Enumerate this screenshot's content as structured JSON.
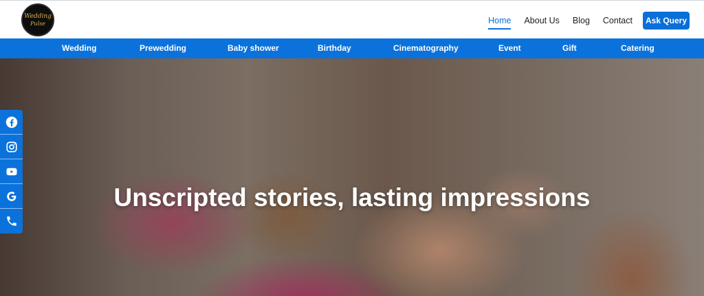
{
  "header": {
    "logo": {
      "line1": "Wedding",
      "line2": "Pulse"
    },
    "nav": [
      {
        "label": "Home",
        "active": true
      },
      {
        "label": "About Us",
        "active": false
      },
      {
        "label": "Blog",
        "active": false
      },
      {
        "label": "Contact",
        "active": false
      }
    ],
    "cta_label": "Ask Query"
  },
  "categories": [
    "Wedding",
    "Prewedding",
    "Baby shower",
    "Birthday",
    "Cinematography",
    "Event",
    "Gift",
    "Catering"
  ],
  "hero": {
    "title": "Unscripted stories, lasting impressions"
  },
  "social": [
    "facebook-icon",
    "instagram-icon",
    "youtube-icon",
    "google-icon",
    "phone-icon"
  ],
  "colors": {
    "accent": "#0b72db",
    "active_nav": "#0a6fd8",
    "text": "#1d1d1d"
  }
}
